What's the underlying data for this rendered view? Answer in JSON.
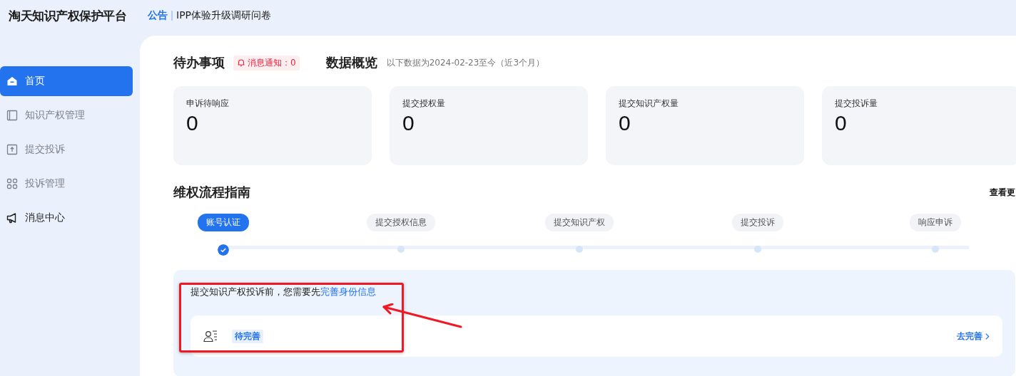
{
  "header": {
    "title": "淘天知识产权保护平台",
    "notice_label": "公告",
    "notice_text": "IPP体验升级调研问卷"
  },
  "sidebar": {
    "items": [
      {
        "label": "首页",
        "selected": true,
        "disabled": false
      },
      {
        "label": "知识产权管理",
        "selected": false,
        "disabled": true
      },
      {
        "label": "提交投诉",
        "selected": false,
        "disabled": true
      },
      {
        "label": "投诉管理",
        "selected": false,
        "disabled": true
      },
      {
        "label": "消息中心",
        "selected": false,
        "disabled": false
      }
    ]
  },
  "todo": {
    "title": "待办事项",
    "badge": "消息通知：0"
  },
  "overview": {
    "title": "数据概览",
    "subtitle": "以下数据为2024-02-23至今（近3个月）",
    "cards": [
      {
        "label": "申诉待响应",
        "value": "0"
      },
      {
        "label": "提交授权量",
        "value": "0"
      },
      {
        "label": "提交知识产权量",
        "value": "0"
      },
      {
        "label": "提交投诉量",
        "value": "0"
      }
    ]
  },
  "guide": {
    "title": "维权流程指南",
    "more": "查看更",
    "steps": [
      {
        "label": "账号认证",
        "selected": true
      },
      {
        "label": "提交授权信息",
        "selected": false
      },
      {
        "label": "提交知识产权",
        "selected": false
      },
      {
        "label": "提交投诉",
        "selected": false
      },
      {
        "label": "响应申诉",
        "selected": false
      }
    ]
  },
  "identity": {
    "message": "提交知识产权投诉前，您需要先",
    "link": "完善身份信息",
    "status": "待完善",
    "action": "去完善"
  }
}
